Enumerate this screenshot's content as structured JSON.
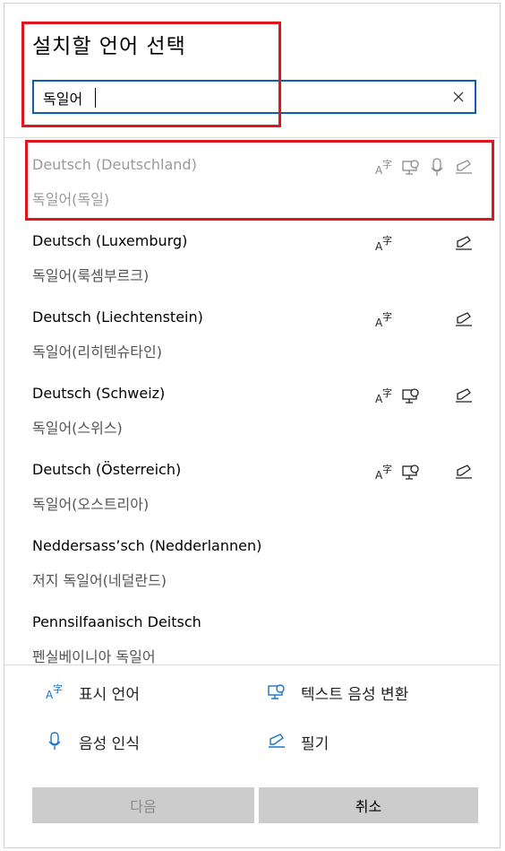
{
  "dialog": {
    "title": "설치할 언어 선택",
    "search": {
      "value": "독일어",
      "placeholder": ""
    }
  },
  "languages": [
    {
      "name": "Deutsch (Deutschland)",
      "native": "독일어(독일)",
      "features": [
        "display",
        "tts",
        "speech",
        "handwriting"
      ],
      "installed": true
    },
    {
      "name": "Deutsch (Luxemburg)",
      "native": "독일어(룩셈부르크)",
      "features": [
        "display",
        "handwriting"
      ]
    },
    {
      "name": "Deutsch (Liechtenstein)",
      "native": "독일어(리히텐슈타인)",
      "features": [
        "display",
        "handwriting"
      ]
    },
    {
      "name": "Deutsch (Schweiz)",
      "native": "독일어(스위스)",
      "features": [
        "display",
        "tts",
        "handwriting"
      ]
    },
    {
      "name": "Deutsch (Österreich)",
      "native": "독일어(오스트리아)",
      "features": [
        "display",
        "tts",
        "handwriting"
      ]
    },
    {
      "name": "Neddersass’sch (Nedderlannen)",
      "native": "저지 독일어(네덜란드)",
      "features": []
    },
    {
      "name": "Pennsilfaanisch Deitsch",
      "native": "펜실베이니아 독일어",
      "features": []
    }
  ],
  "legend": {
    "display": "표시 언어",
    "tts": "텍스트 음성 변환",
    "speech": "음성 인식",
    "handwriting": "필기"
  },
  "buttons": {
    "next": "다음",
    "cancel": "취소"
  },
  "colors": {
    "accent": "#0a5fae",
    "highlight": "#e0161e",
    "legend_icon": "#1a73c9"
  }
}
